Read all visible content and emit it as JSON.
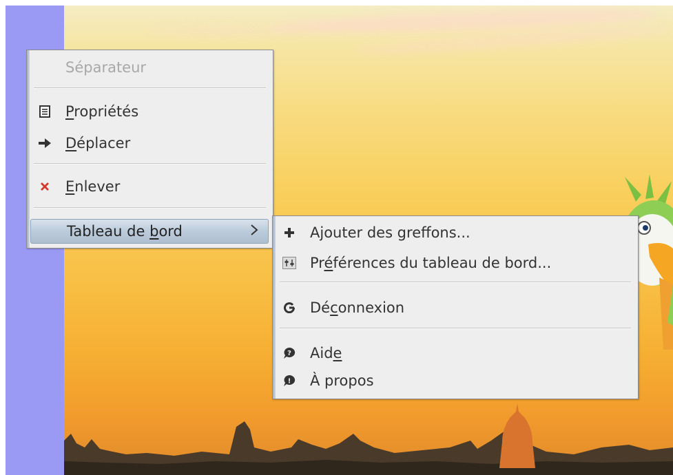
{
  "panel": {
    "color": "#9a9af5"
  },
  "desktop": {
    "wallpaper": "sunset-city-parrot"
  },
  "context_menu": {
    "items": [
      {
        "label": "Séparateur",
        "enabled": false
      },
      {
        "label_pre": "",
        "mnemonic": "P",
        "label_post": "ropriétés",
        "icon": "properties-icon"
      },
      {
        "label_pre": "",
        "mnemonic": "D",
        "label_post": "éplacer",
        "icon": "move-arrow-icon"
      },
      {
        "label_pre": "",
        "mnemonic": "E",
        "label_post": "nlever",
        "icon": "remove-x-icon"
      },
      {
        "label_pre": "Tableau de ",
        "mnemonic": "b",
        "label_post": "ord",
        "icon": "submenu-chevron-icon",
        "highlighted": true
      }
    ]
  },
  "submenu": {
    "items": [
      {
        "label_pre": "",
        "mnemonic": "",
        "label_post": "Ajouter des greffons...",
        "icon": "plus-icon"
      },
      {
        "label_pre": "Pr",
        "mnemonic": "é",
        "label_post": "férences du tableau de bord...",
        "icon": "panel-preferences-icon"
      },
      {
        "label_pre": "Dé",
        "mnemonic": "c",
        "label_post": "onnexion",
        "icon": "logout-icon"
      },
      {
        "label_pre": "Aid",
        "mnemonic": "e",
        "label_post": "",
        "icon": "help-icon"
      },
      {
        "label_pre": "",
        "mnemonic": "",
        "label_post": "À propos",
        "icon": "about-icon"
      }
    ]
  },
  "colors": {
    "menu_bg": "#eeeeee",
    "highlight": "#bccbdb",
    "remove_icon": "#d23a2a",
    "disabled_text": "#a8a8a8"
  }
}
